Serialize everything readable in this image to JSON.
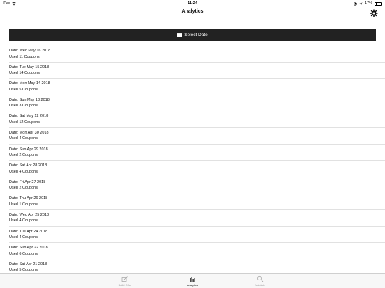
{
  "status_bar": {
    "device": "iPad",
    "time": "11:24",
    "battery": "17%"
  },
  "nav": {
    "title": "Analytics",
    "settings_icon": "gear-icon"
  },
  "select_date": {
    "label": "Select Date",
    "icon": "calendar-icon"
  },
  "entries": [
    {
      "date": "Date: Wed May 16 2018",
      "used": "Used 11 Coupons"
    },
    {
      "date": "Date: Tue May 15 2018",
      "used": "Used 14 Coupons"
    },
    {
      "date": "Date: Mon May 14 2018",
      "used": "Used 5 Coupons"
    },
    {
      "date": "Date: Sun May 13 2018",
      "used": "Used 3 Coupons"
    },
    {
      "date": "Date: Sat May 12 2018",
      "used": "Used 12 Coupons"
    },
    {
      "date": "Date: Mon Apr 30 2018",
      "used": "Used 4 Coupons"
    },
    {
      "date": "Date: Sun Apr 29 2018",
      "used": "Used 2 Coupons"
    },
    {
      "date": "Date: Sat Apr 28 2018",
      "used": "Used 4 Coupons"
    },
    {
      "date": "Date: Fri Apr 27 2018",
      "used": "Used 2 Coupons"
    },
    {
      "date": "Date: Thu Apr 26 2018",
      "used": "Used 1 Coupons"
    },
    {
      "date": "Date: Wed Apr 25 2018",
      "used": "Used 4 Coupons"
    },
    {
      "date": "Date: Tue Apr 24 2018",
      "used": "Used 4 Coupons"
    },
    {
      "date": "Date: Sun Apr 22 2018",
      "used": "Used 6 Coupons"
    },
    {
      "date": "Date: Sat Apr 21 2018",
      "used": "Used 5 Coupons"
    }
  ],
  "tabs": [
    {
      "label": "Build Offer",
      "icon": "compose-icon",
      "active": false
    },
    {
      "label": "Analytics",
      "icon": "bar-chart-icon",
      "active": true
    },
    {
      "label": "Validate",
      "icon": "search-icon",
      "active": false
    }
  ],
  "colors": {
    "button_bg": "#222222",
    "tab_inactive": "#9a9a9a",
    "tab_active": "#111111"
  }
}
